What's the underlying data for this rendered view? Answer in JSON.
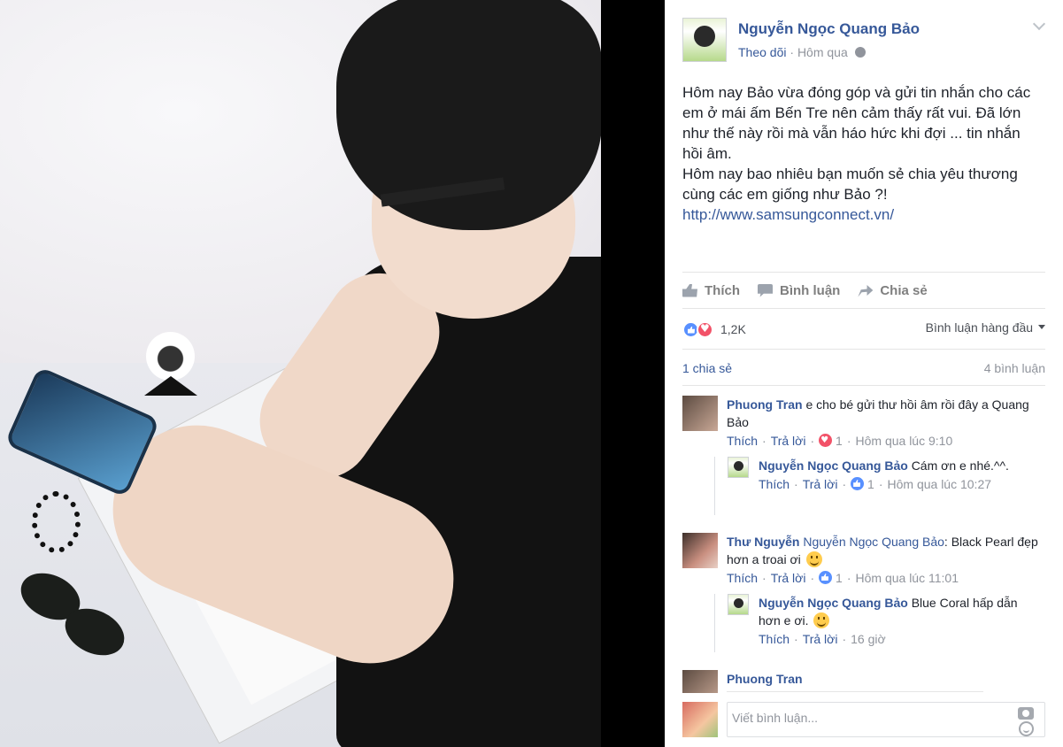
{
  "post": {
    "author": "Nguyễn Ngọc Quang Bảo",
    "follow_label": "Theo dõi",
    "separator": "·",
    "time": "Hôm qua",
    "text_lines": [
      "Hôm nay Bảo vừa đóng góp và gửi tin nhắn cho các",
      "em ở mái ấm Bến Tre nên cảm thấy rất vui. Đã lớn",
      "như thế này rồi mà vẫn háo hức khi đợi ... tin nhắn",
      "hồi âm.",
      "Hôm nay bao nhiêu bạn muốn sẻ chia yêu thương",
      "cùng các em giống như Bảo ?!"
    ],
    "link": "http://www.samsungconnect.vn/"
  },
  "actions": {
    "like": "Thích",
    "comment": "Bình luận",
    "share": "Chia sẻ"
  },
  "reactions": {
    "count": "1,2K",
    "sort_label": "Bình luận hàng đầu",
    "shares": "1 chia sẻ",
    "comments": "4 bình luận"
  },
  "comments": [
    {
      "name": "Phuong Tran",
      "text": "e cho bé gửi thư hồi âm rồi đây a Quang Bảo",
      "like": "Thích",
      "reply": "Trả lời",
      "reaction_count": "1",
      "time": "Hôm qua lúc 9:10",
      "reply_item": {
        "name": "Nguyễn Ngọc Quang Bảo",
        "text": "Cám ơn e nhé.^^.",
        "like": "Thích",
        "reply": "Trả lời",
        "reaction_count": "1",
        "time": "Hôm qua lúc 10:27"
      }
    },
    {
      "name": "Thư Nguyễn",
      "mention": "Nguyễn Ngọc Quang Bảo",
      "text": ": Black Pearl đẹp hơn a troai ơi",
      "like": "Thích",
      "reply": "Trả lời",
      "reaction_count": "1",
      "time": "Hôm qua lúc 11:01",
      "reply_item": {
        "name": "Nguyễn Ngọc Quang Bảo",
        "text": "Blue Coral hấp dẫn hơn e ơi.",
        "like": "Thích",
        "reply": "Trả lời",
        "time": "16 giờ"
      }
    },
    {
      "name": "Phuong Tran"
    }
  ],
  "composer": {
    "placeholder": "Viết bình luận..."
  },
  "colors": {
    "link": "#365899",
    "meta": "#90949c",
    "like_blue": "#5890ff",
    "love_red": "#f25268"
  }
}
